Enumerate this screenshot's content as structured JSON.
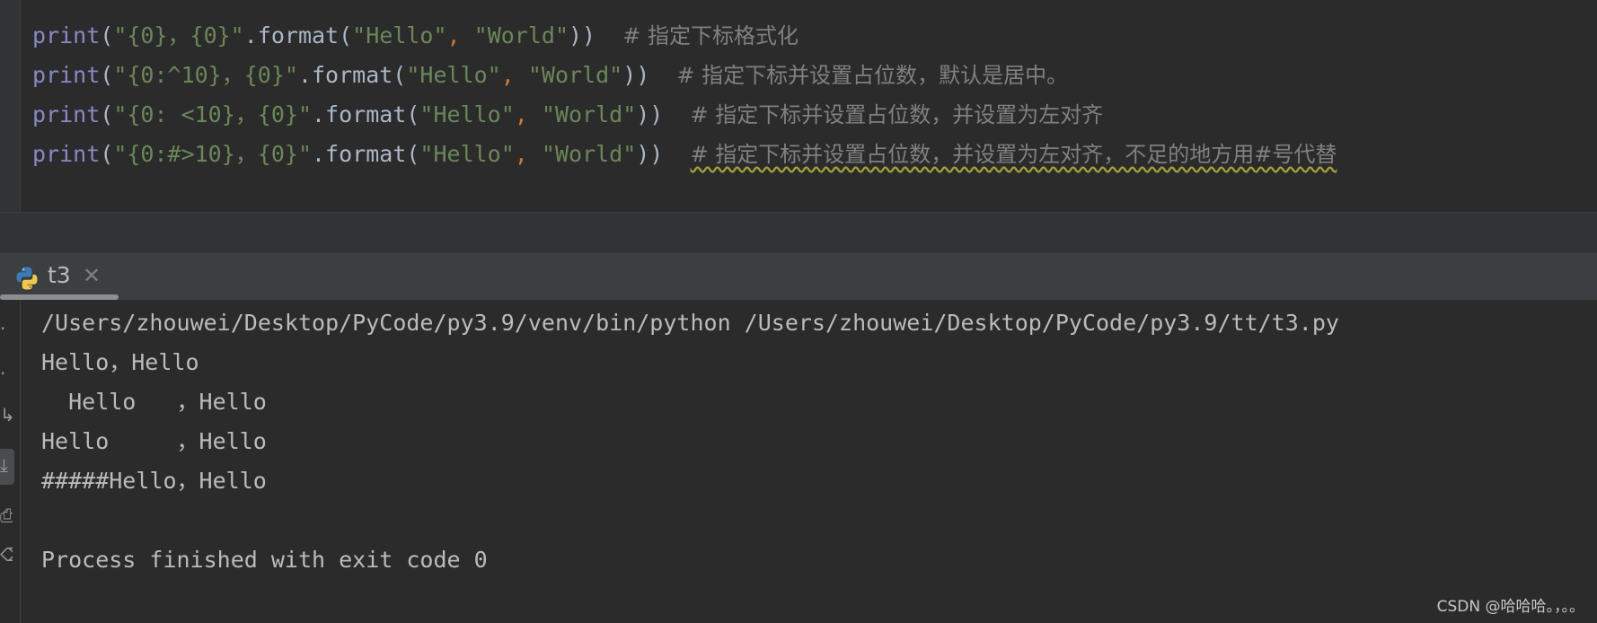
{
  "editor": {
    "lines": [
      {
        "kw": "print",
        "p1": "(",
        "s1": "\"{0}，{0}\"",
        "fn": ".format(",
        "s2": "\"Hello\"",
        "comma": ", ",
        "s3": "\"World\"",
        "p2": "))",
        "gap": "  ",
        "comment": "# 指定下标格式化"
      },
      {
        "kw": "print",
        "p1": "(",
        "s1": "\"{0:^10}，{0}\"",
        "fn": ".format(",
        "s2": "\"Hello\"",
        "comma": ", ",
        "s3": "\"World\"",
        "p2": "))",
        "gap": "  ",
        "comment": "# 指定下标并设置占位数，默认是居中。"
      },
      {
        "kw": "print",
        "p1": "(",
        "s1": "\"{0: <10}，{0}\"",
        "fn": ".format(",
        "s2": "\"Hello\"",
        "comma": ", ",
        "s3": "\"World\"",
        "p2": "))",
        "gap": "  ",
        "comment": "# 指定下标并设置占位数，并设置为左对齐"
      },
      {
        "kw": "print",
        "p1": "(",
        "s1": "\"{0:#>10}，{0}\"",
        "fn": ".format(",
        "s2": "\"Hello\"",
        "comma": ", ",
        "s3": "\"World\"",
        "p2": "))",
        "gap": "  ",
        "comment": "# 指定下标并设置占位数，并设置为左对齐，不足的地方用#号代替"
      }
    ]
  },
  "run_panel": {
    "tab_label": "t3",
    "tab_icon": "python-icon",
    "close_glyph": "✕"
  },
  "console": {
    "lines": [
      "/Users/zhouwei/Desktop/PyCode/py3.9/venv/bin/python /Users/zhouwei/Desktop/PyCode/py3.9/tt/t3.py",
      "Hello，Hello",
      "  Hello   ，Hello",
      "Hello     ，Hello",
      "#####Hello，Hello",
      "",
      "Process finished with exit code 0"
    ]
  },
  "watermark": "CSDN @哈哈哈。，。。",
  "colors": {
    "background": "#2b2b2b",
    "keyword": "#8888c6",
    "string": "#6a8759",
    "operator": "#cc7832",
    "comment": "#808080",
    "console_text": "#bbbbbb"
  }
}
